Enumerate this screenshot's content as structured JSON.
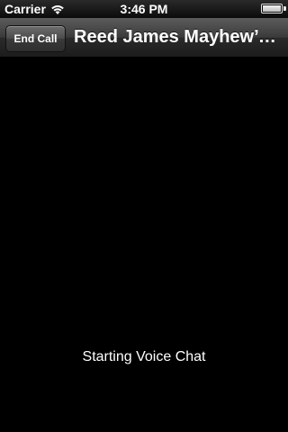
{
  "status_bar": {
    "carrier": "Carrier",
    "time": "3:46 PM",
    "wifi_icon": "wifi-icon",
    "battery_icon": "battery-icon",
    "battery_level": 1.0
  },
  "nav": {
    "end_call_label": "End Call",
    "title": "Reed James Mayhew’s iPhone"
  },
  "content": {
    "status_message": "Starting Voice Chat"
  }
}
